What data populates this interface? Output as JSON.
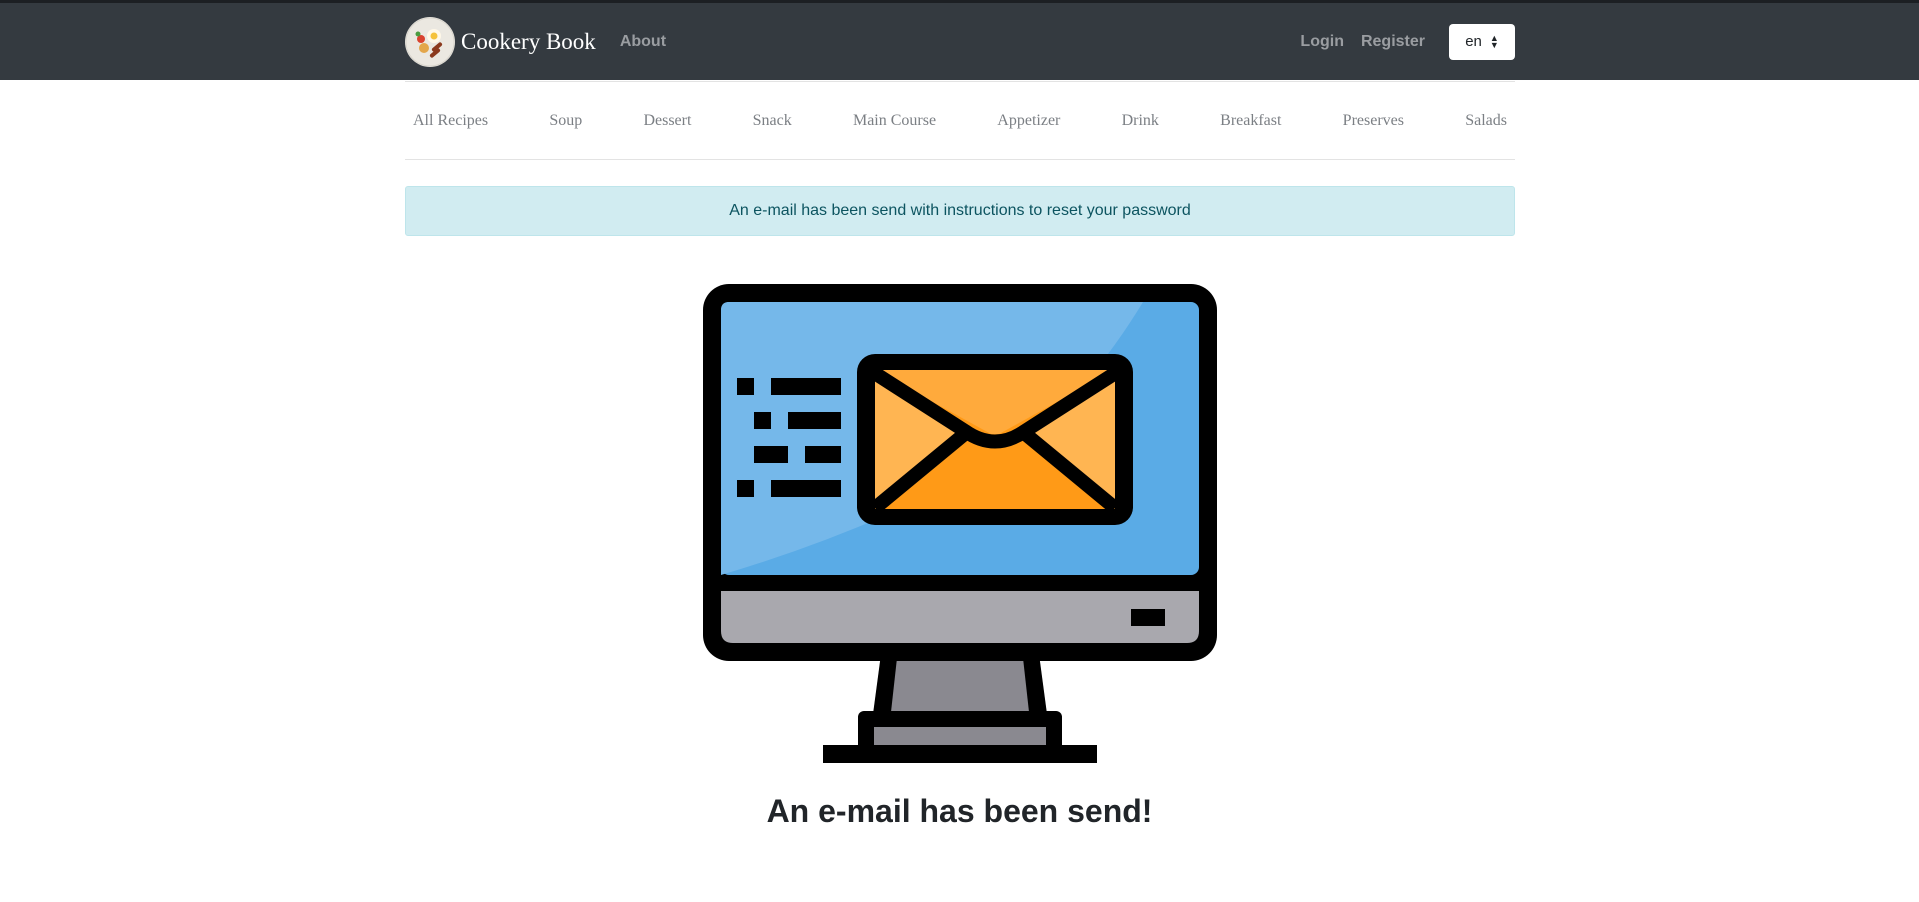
{
  "navbar": {
    "brand": "Cookery Book",
    "about": "About",
    "login": "Login",
    "register": "Register",
    "language": "en",
    "logo_icon": "food-plate-icon"
  },
  "categories": [
    "All Recipes",
    "Soup",
    "Dessert",
    "Snack",
    "Main Course",
    "Appetizer",
    "Drink",
    "Breakfast",
    "Preserves",
    "Salads"
  ],
  "alert": {
    "message": "An e-mail has been send with instructions to reset your password"
  },
  "illustration": {
    "icon": "monitor-envelope-icon"
  },
  "heading": "An e-mail has been send!",
  "colors": {
    "navbar": "#343a40",
    "alert_bg": "#d1ecf1",
    "alert_text": "#0c5460",
    "screen_blue": "#5aabe6",
    "envelope_orange": "#ffa133"
  }
}
